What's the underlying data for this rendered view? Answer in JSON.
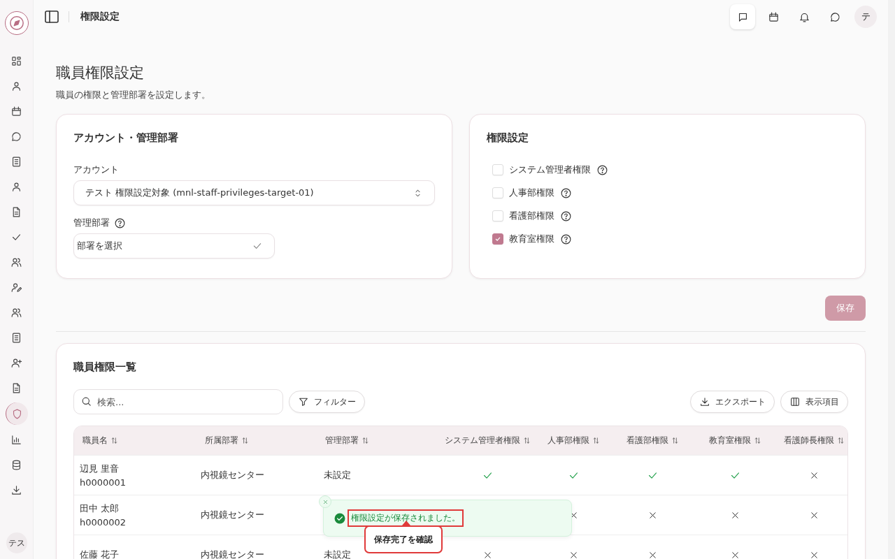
{
  "sidebar": {
    "items": [
      {
        "kind": "grid",
        "selected": false
      },
      {
        "kind": "person",
        "selected": false
      },
      {
        "kind": "calendar",
        "selected": false
      },
      {
        "kind": "chat",
        "selected": false
      },
      {
        "kind": "book",
        "selected": false
      },
      {
        "kind": "person",
        "selected": false
      },
      {
        "kind": "document",
        "selected": false
      },
      {
        "kind": "check",
        "selected": false
      },
      {
        "kind": "people",
        "selected": false
      },
      {
        "kind": "person-edit",
        "selected": false
      },
      {
        "kind": "people",
        "selected": false
      },
      {
        "kind": "book",
        "selected": false
      },
      {
        "kind": "person-plus",
        "selected": false
      },
      {
        "kind": "document",
        "selected": false
      },
      {
        "kind": "shield",
        "selected": true
      },
      {
        "kind": "chart",
        "selected": false
      },
      {
        "kind": "database",
        "selected": false
      },
      {
        "kind": "download",
        "selected": false
      }
    ],
    "user": "テス"
  },
  "topbar": {
    "title": "権限設定",
    "actions": [
      {
        "kind": "message",
        "selected": true
      },
      {
        "kind": "calendar",
        "selected": false
      },
      {
        "kind": "bell",
        "selected": false
      },
      {
        "kind": "chat",
        "selected": false
      }
    ],
    "avatar": "テ"
  },
  "page": {
    "title": "職員権限設定",
    "subtitle": "職員の権限と管理部署を設定します。"
  },
  "account_card": {
    "title": "アカウント・管理部署",
    "account_label": "アカウント",
    "account_value": "テスト 権限設定対象 (mnl-staff-privileges-target-01)",
    "department_label": "管理部署",
    "department_placeholder": "部署を選択"
  },
  "privilege_card": {
    "title": "権限設定",
    "options": [
      {
        "label": "システム管理者権限",
        "checked": false
      },
      {
        "label": "人事部権限",
        "checked": false
      },
      {
        "label": "看護部権限",
        "checked": false
      },
      {
        "label": "教育室権限",
        "checked": true
      }
    ]
  },
  "save_button": "保存",
  "table_card": {
    "title": "職員権限一覧",
    "search_placeholder": "検索...",
    "filter_button": "フィルター",
    "export_button": "エクスポート",
    "columns_button": "表示項目",
    "columns": [
      "職員名",
      "所属部署",
      "管理部署",
      "システム管理者権限",
      "人事部権限",
      "看護部権限",
      "教育室権限",
      "看護師長権限"
    ],
    "rows": [
      {
        "cells": [
          {
            "kind": "staff",
            "name": "辺見 里音",
            "id": "h0000001"
          },
          {
            "kind": "text",
            "text": "内視鏡センター"
          },
          {
            "kind": "text",
            "text": "未設定"
          },
          {
            "kind": "yes"
          },
          {
            "kind": "yes"
          },
          {
            "kind": "yes"
          },
          {
            "kind": "yes"
          },
          {
            "kind": "no"
          }
        ]
      },
      {
        "cells": [
          {
            "kind": "staff",
            "name": "田中 太郎",
            "id": "h0000002"
          },
          {
            "kind": "text",
            "text": "内視鏡センター"
          },
          {
            "kind": "covered"
          },
          {
            "kind": "covered"
          },
          {
            "kind": "no"
          },
          {
            "kind": "no"
          },
          {
            "kind": "no"
          },
          {
            "kind": "no"
          }
        ]
      },
      {
        "cells": [
          {
            "kind": "staff",
            "name": "佐藤 花子"
          },
          {
            "kind": "text",
            "text": "内視鏡センター"
          },
          {
            "kind": "text",
            "text": "未設定"
          },
          {
            "kind": "no"
          },
          {
            "kind": "no"
          },
          {
            "kind": "no"
          },
          {
            "kind": "no"
          },
          {
            "kind": "no"
          }
        ]
      }
    ]
  },
  "toast": {
    "message": "権限設定が保存されました。",
    "callout": "保存完了を確認"
  }
}
